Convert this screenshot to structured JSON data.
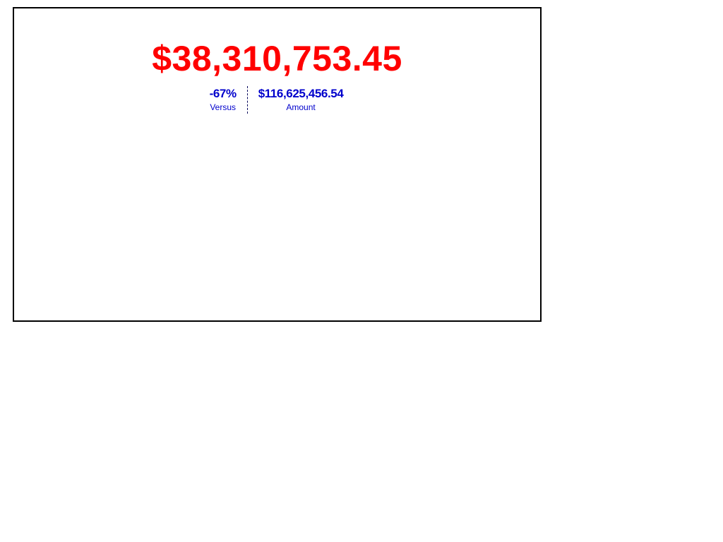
{
  "kpi": {
    "value": "$38,310,753.45",
    "value_color": "#ff0000",
    "versus": {
      "value": "-67%",
      "label": "Versus"
    },
    "amount": {
      "value": "$116,625,456.54",
      "label": "Amount"
    },
    "compare_color": "#0000cc"
  }
}
